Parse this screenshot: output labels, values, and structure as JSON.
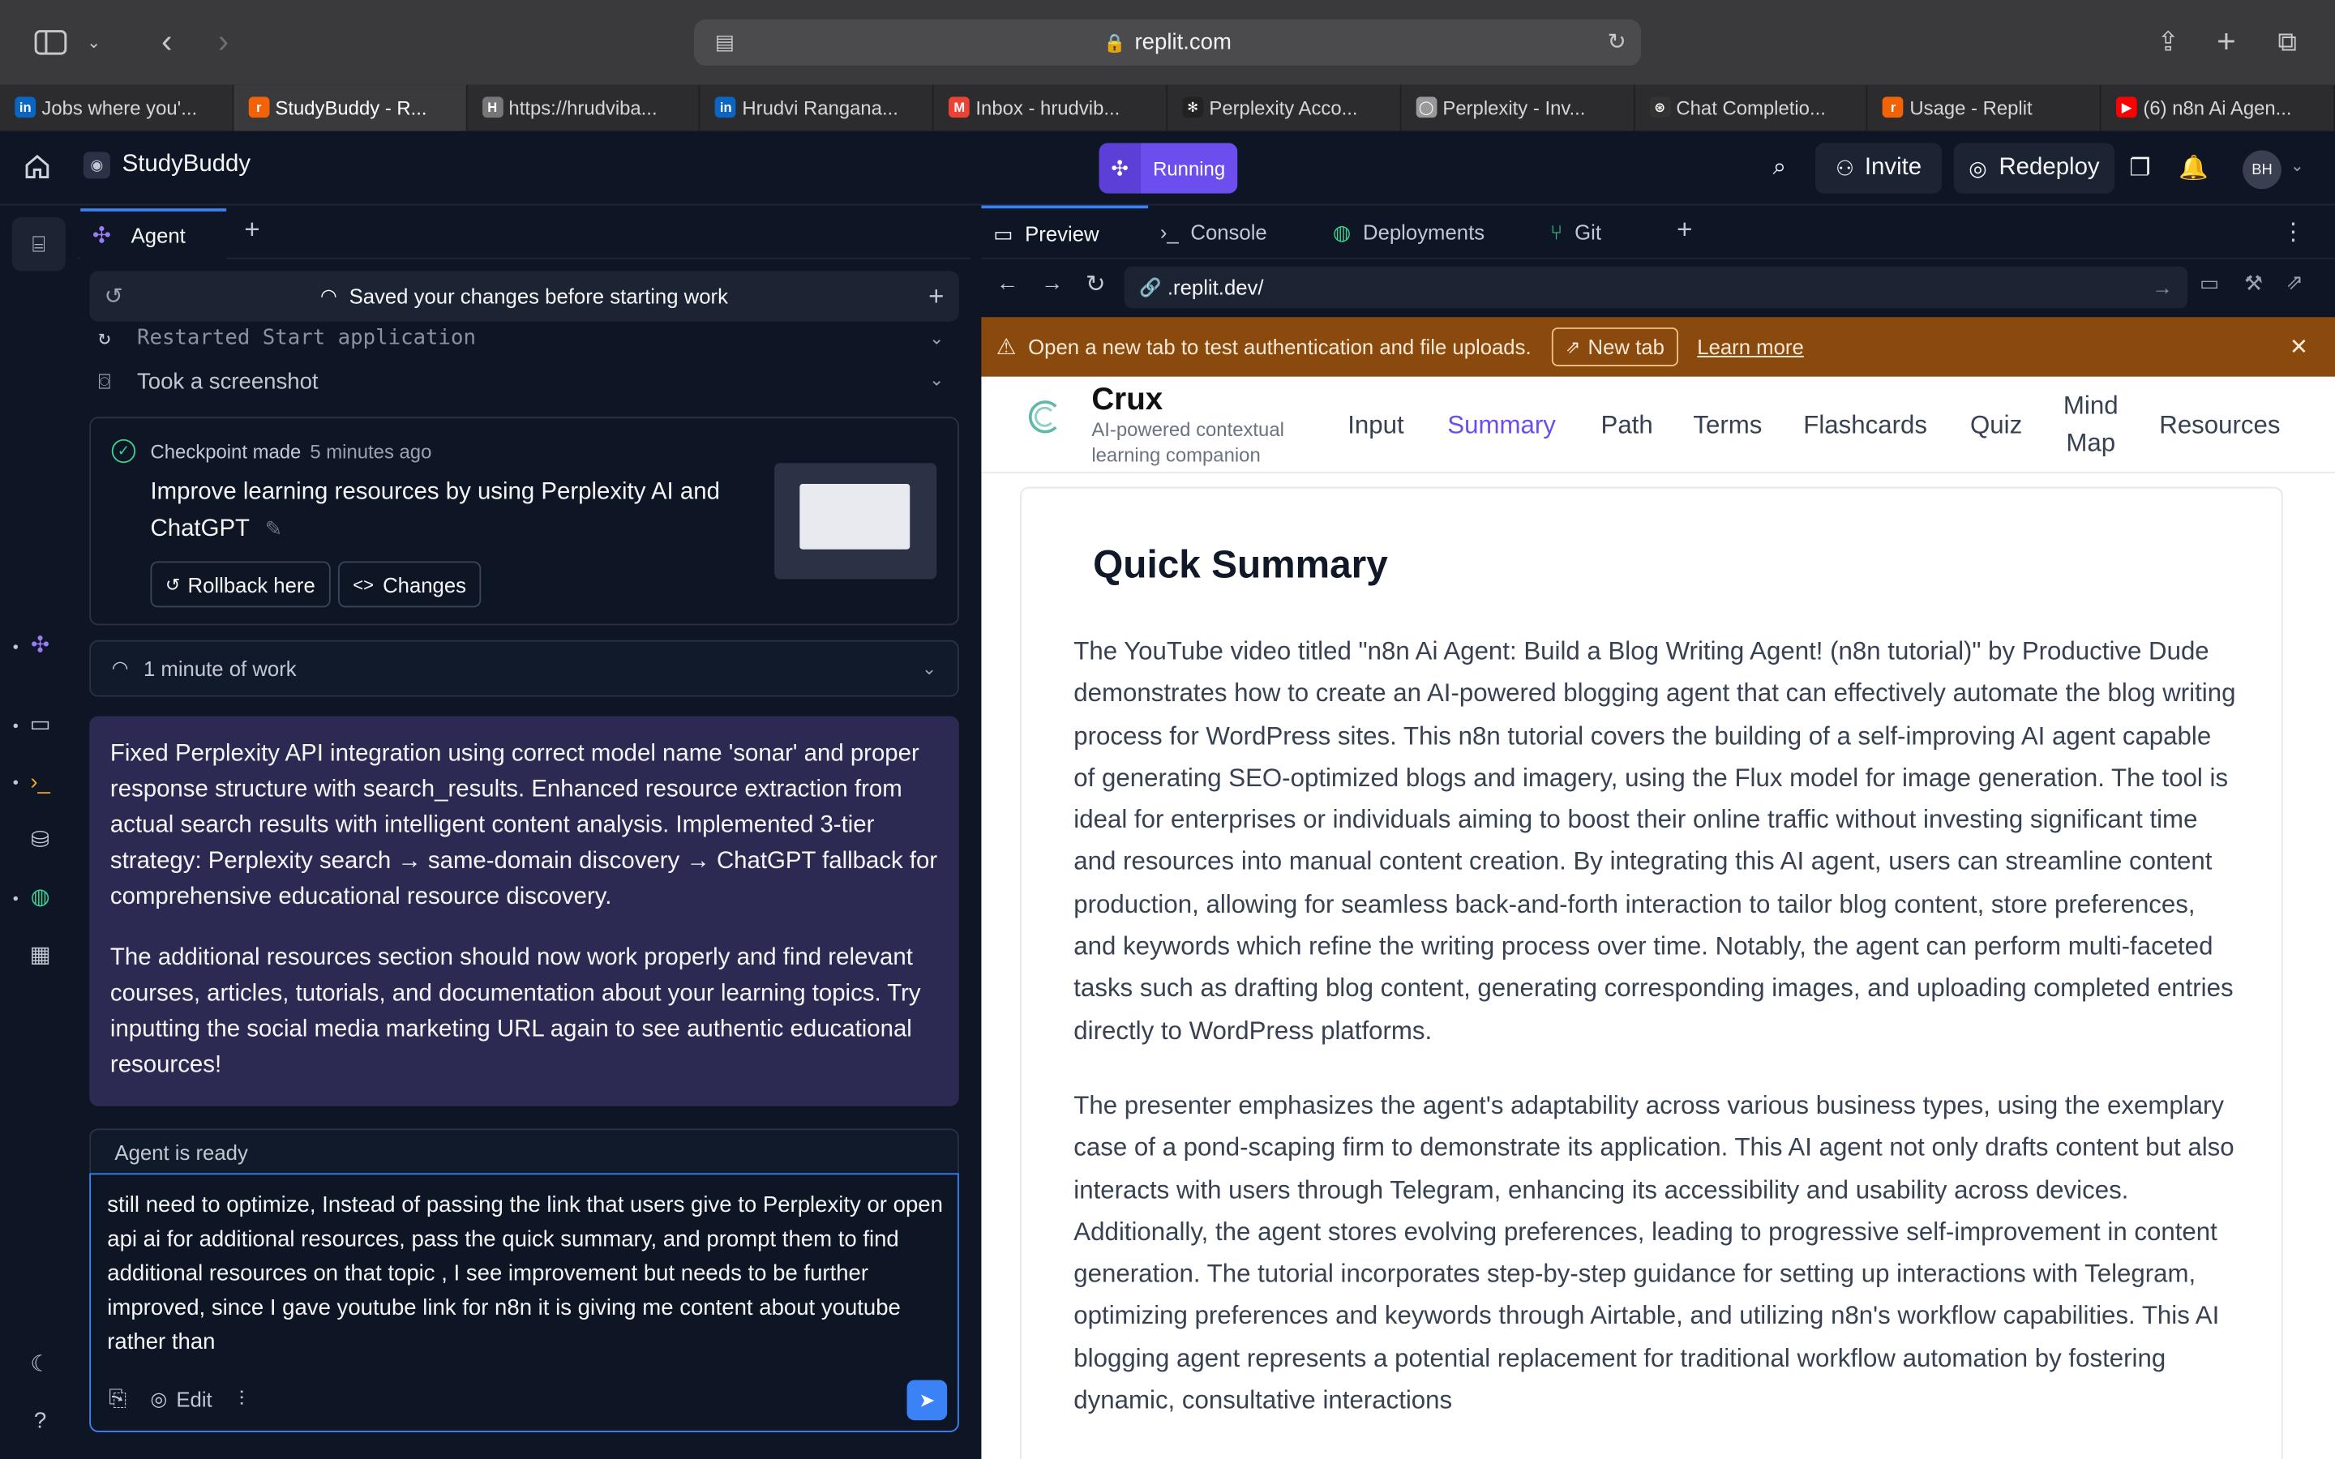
{
  "browser": {
    "url": "replit.com",
    "tabs": [
      {
        "label": "Jobs where you'...",
        "fav": "in",
        "color": "#0a66c2"
      },
      {
        "label": "StudyBuddy - R...",
        "fav": "r",
        "color": "#f26207"
      },
      {
        "label": "https://hrudviba...",
        "fav": "H",
        "color": "#777777"
      },
      {
        "label": "Hrudvi Ranganа...",
        "fav": "in",
        "color": "#0a66c2"
      },
      {
        "label": "Inbox - hrudvib...",
        "fav": "M",
        "color": "#ea4335"
      },
      {
        "label": "Perplexity Acco...",
        "fav": "✻",
        "color": "#222222"
      },
      {
        "label": "Perplexity - Inv...",
        "fav": "◯",
        "color": "#999999"
      },
      {
        "label": "Chat Completio...",
        "fav": "⊛",
        "color": "#333333"
      },
      {
        "label": "Usage - Replit",
        "fav": "r",
        "color": "#f26207"
      },
      {
        "label": "(6) n8n Ai Agen...",
        "fav": "▶",
        "color": "#ff0000"
      }
    ]
  },
  "header": {
    "project": "StudyBuddy",
    "run_label": "Running",
    "invite": "Invite",
    "redeploy": "Redeploy",
    "avatar": "BH"
  },
  "agent": {
    "tab": "Agent",
    "saved": "Saved your changes before starting work",
    "restarted": "Restarted Start application",
    "screenshot": "Took a screenshot",
    "checkpoint": {
      "label": "Checkpoint made",
      "time": "5 minutes ago",
      "title": "Improve learning resources by using Perplexity AI and ChatGPT",
      "rollback": "Rollback here",
      "changes": "Changes"
    },
    "work": "1 minute of work",
    "message": [
      "Fixed Perplexity API integration using correct model name 'sonar' and proper response structure with search_results. Enhanced resource extraction from actual search results with intelligent content analysis. Implemented 3-tier strategy: Perplexity search → same-domain discovery → ChatGPT fallback for comprehensive educational resource discovery.",
      "The additional resources section should now work properly and find relevant courses, articles, tutorials, and documentation about your learning topics. Try inputting the social media marketing URL again to see authentic educational resources!"
    ],
    "ready": "Agent is ready",
    "input": "still need to optimize, Instead of passing the link that users give to Perplexity or open api ai for additional resources, pass the quick summary, and prompt them to find additional resources on that topic , I see improvement but needs to be further improved, since I gave youtube link for n8n it is giving me content about youtube rather than",
    "edit": "Edit"
  },
  "preview": {
    "tabs": [
      "Preview",
      "Console",
      "Deployments",
      "Git"
    ],
    "url": ".replit.dev/",
    "warning": "Open a new tab to test authentication and file uploads.",
    "new_tab": "New tab",
    "learn_more": "Learn more",
    "site": {
      "brand": "Crux",
      "tagline": "AI-powered contextual learning companion",
      "nav": [
        "Input",
        "Summary",
        "Path",
        "Terms",
        "Flashcards",
        "Quiz",
        "Mind Map",
        "Resources"
      ],
      "active": "Summary",
      "heading": "Quick Summary",
      "paragraphs": [
        "The YouTube video titled \"n8n Ai Agent: Build a Blog Writing Agent! (n8n tutorial)\" by Productive Dude demonstrates how to create an AI-powered blogging agent that can effectively automate the blog writing process for WordPress sites. This n8n tutorial covers the building of a self-improving AI agent capable of generating SEO-optimized blogs and imagery, using the Flux model for image generation. The tool is ideal for enterprises or individuals aiming to boost their online traffic without investing significant time and resources into manual content creation. By integrating this AI agent, users can streamline content production, allowing for seamless back-and-forth interaction to tailor blog content, store preferences, and keywords which refine the writing process over time. Notably, the agent can perform multi-faceted tasks such as drafting blog content, generating corresponding images, and uploading completed entries directly to WordPress platforms.",
        "The presenter emphasizes the agent's adaptability across various business types, using the exemplary case of a pond-scaping firm to demonstrate its application. This AI agent not only drafts content but also interacts with users through Telegram, enhancing its accessibility and usability across devices. Additionally, the agent stores evolving preferences, leading to progressive self-improvement in content generation. The tutorial incorporates step-by-step guidance for setting up interactions with Telegram, optimizing preferences and keywords through Airtable, and utilizing n8n's workflow capabilities. This AI blogging agent represents a potential replacement for traditional workflow automation by fostering dynamic, consultative interactions"
      ]
    }
  }
}
